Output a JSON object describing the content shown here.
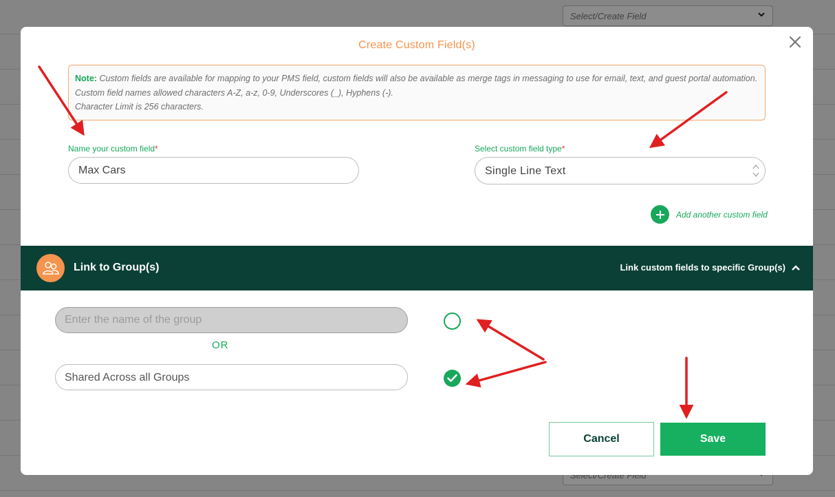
{
  "background": {
    "select_placeholder": "Select/Create Field"
  },
  "modal": {
    "title": "Create Custom Field(s)",
    "note": {
      "label": "Note:",
      "line1": "Custom fields are available for mapping to your PMS field, custom fields will also be available as merge tags in messaging to use for email, text, and guest portal automation.",
      "line2": "Custom field names allowed characters A-Z, a-z, 0-9, Underscores (_), Hyphens (-).",
      "line3": "Character Limit is 256 characters."
    },
    "name_field": {
      "label": "Name your custom field",
      "required_mark": "*",
      "value": "Max Cars"
    },
    "type_field": {
      "label": "Select custom field type",
      "required_mark": "*",
      "value": "Single Line Text"
    },
    "add_another_label": "Add another custom field",
    "group_section": {
      "title": "Link to Group(s)",
      "link_label": "Link custom fields to specific Group(s)",
      "group_input_placeholder": "Enter the name of the group",
      "or_label": "OR",
      "shared_label": "Shared Across all Groups",
      "selected_option": "shared"
    },
    "buttons": {
      "cancel": "Cancel",
      "save": "Save"
    }
  },
  "colors": {
    "accent_green": "#17a85a",
    "title_orange": "#f5944e",
    "group_bar": "#0a4035",
    "annotation_arrow": "#e02020"
  }
}
